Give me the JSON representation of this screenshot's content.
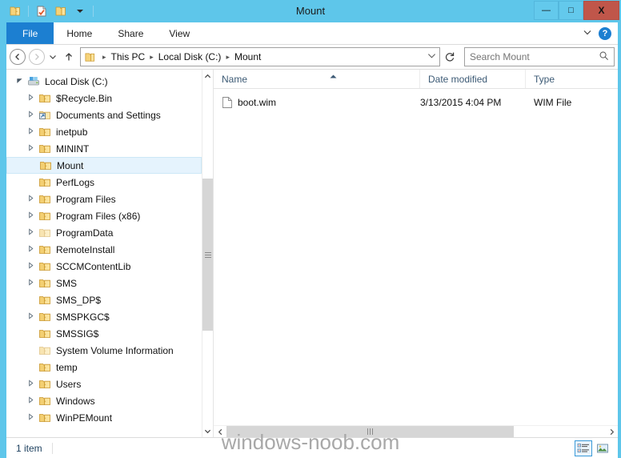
{
  "window": {
    "title": "Mount",
    "quick_access": [
      {
        "name": "folder-icon",
        "label": "Folder"
      },
      {
        "name": "properties-icon",
        "label": "Properties"
      },
      {
        "name": "new-folder-icon",
        "label": "New folder"
      },
      {
        "name": "chevron-down-icon",
        "label": "Customize Quick Access Toolbar"
      }
    ],
    "controls": {
      "minimize": "—",
      "maximize": "□",
      "close": "X"
    },
    "accent_color": "#5ec6ea",
    "close_color": "#c0564a"
  },
  "ribbon": {
    "tabs": [
      {
        "label": "File",
        "active": true
      },
      {
        "label": "Home",
        "active": false
      },
      {
        "label": "Share",
        "active": false
      },
      {
        "label": "View",
        "active": false
      }
    ],
    "collapse_icon": "chevron-down-icon",
    "help_label": "?"
  },
  "navigation": {
    "back_label": "←",
    "forward_label": "→",
    "recent_label": "⌄",
    "up_label": "↑",
    "breadcrumbs": [
      "This PC",
      "Local Disk (C:)",
      "Mount"
    ],
    "breadcrumb_separator": "▸",
    "dropdown_label": "⌄",
    "refresh_label": "↻"
  },
  "search": {
    "placeholder": "Search Mount",
    "value": "",
    "icon": "search-icon"
  },
  "tree": {
    "items": [
      {
        "label": "Local Disk (C:)",
        "indent": 0,
        "expander": "expanded",
        "icon": "drive-icon",
        "selected": false,
        "dim": false
      },
      {
        "label": "$Recycle.Bin",
        "indent": 1,
        "expander": "collapsed",
        "icon": "folder-icon",
        "selected": false,
        "dim": false
      },
      {
        "label": "Documents and Settings",
        "indent": 1,
        "expander": "collapsed",
        "icon": "shortcut-folder-icon",
        "selected": false,
        "dim": false
      },
      {
        "label": "inetpub",
        "indent": 1,
        "expander": "collapsed",
        "icon": "folder-icon",
        "selected": false,
        "dim": false
      },
      {
        "label": "MININT",
        "indent": 1,
        "expander": "collapsed",
        "icon": "folder-icon",
        "selected": false,
        "dim": false
      },
      {
        "label": "Mount",
        "indent": 1,
        "expander": "none",
        "icon": "folder-icon",
        "selected": true,
        "dim": false
      },
      {
        "label": "PerfLogs",
        "indent": 1,
        "expander": "none",
        "icon": "folder-icon",
        "selected": false,
        "dim": false
      },
      {
        "label": "Program Files",
        "indent": 1,
        "expander": "collapsed",
        "icon": "folder-icon",
        "selected": false,
        "dim": false
      },
      {
        "label": "Program Files (x86)",
        "indent": 1,
        "expander": "collapsed",
        "icon": "folder-icon",
        "selected": false,
        "dim": false
      },
      {
        "label": "ProgramData",
        "indent": 1,
        "expander": "collapsed",
        "icon": "folder-icon",
        "selected": false,
        "dim": true
      },
      {
        "label": "RemoteInstall",
        "indent": 1,
        "expander": "collapsed",
        "icon": "folder-icon",
        "selected": false,
        "dim": false
      },
      {
        "label": "SCCMContentLib",
        "indent": 1,
        "expander": "collapsed",
        "icon": "folder-icon",
        "selected": false,
        "dim": false
      },
      {
        "label": "SMS",
        "indent": 1,
        "expander": "collapsed",
        "icon": "folder-icon",
        "selected": false,
        "dim": false
      },
      {
        "label": "SMS_DP$",
        "indent": 1,
        "expander": "none",
        "icon": "folder-icon",
        "selected": false,
        "dim": false
      },
      {
        "label": "SMSPKGC$",
        "indent": 1,
        "expander": "collapsed",
        "icon": "folder-icon",
        "selected": false,
        "dim": false
      },
      {
        "label": "SMSSIG$",
        "indent": 1,
        "expander": "none",
        "icon": "folder-icon",
        "selected": false,
        "dim": false
      },
      {
        "label": "System Volume Information",
        "indent": 1,
        "expander": "none",
        "icon": "folder-icon",
        "selected": false,
        "dim": true
      },
      {
        "label": "temp",
        "indent": 1,
        "expander": "none",
        "icon": "folder-icon",
        "selected": false,
        "dim": false
      },
      {
        "label": "Users",
        "indent": 1,
        "expander": "collapsed",
        "icon": "folder-icon",
        "selected": false,
        "dim": false
      },
      {
        "label": "Windows",
        "indent": 1,
        "expander": "collapsed",
        "icon": "folder-icon",
        "selected": false,
        "dim": false
      },
      {
        "label": "WinPEMount",
        "indent": 1,
        "expander": "collapsed",
        "icon": "folder-icon",
        "selected": false,
        "dim": false
      }
    ],
    "expander_expanded": "◢",
    "expander_collapsed": "▷"
  },
  "file_list": {
    "columns": [
      {
        "key": "name",
        "label": "Name",
        "sorted": "asc"
      },
      {
        "key": "date",
        "label": "Date modified",
        "sorted": ""
      },
      {
        "key": "type",
        "label": "Type",
        "sorted": ""
      }
    ],
    "rows": [
      {
        "name": "boot.wim",
        "date": "3/13/2015 4:04 PM",
        "type": "WIM File",
        "icon": "file-icon"
      }
    ]
  },
  "status": {
    "item_count": "1 item",
    "view_buttons": [
      {
        "name": "details-view-button",
        "active": true
      },
      {
        "name": "large-icons-view-button",
        "active": false
      }
    ]
  },
  "watermark": {
    "text": "windows-noob.com"
  },
  "scrollbars": {
    "tree_up": "⌃",
    "tree_down": "⌄",
    "list_left": "‹",
    "list_right": "›"
  }
}
